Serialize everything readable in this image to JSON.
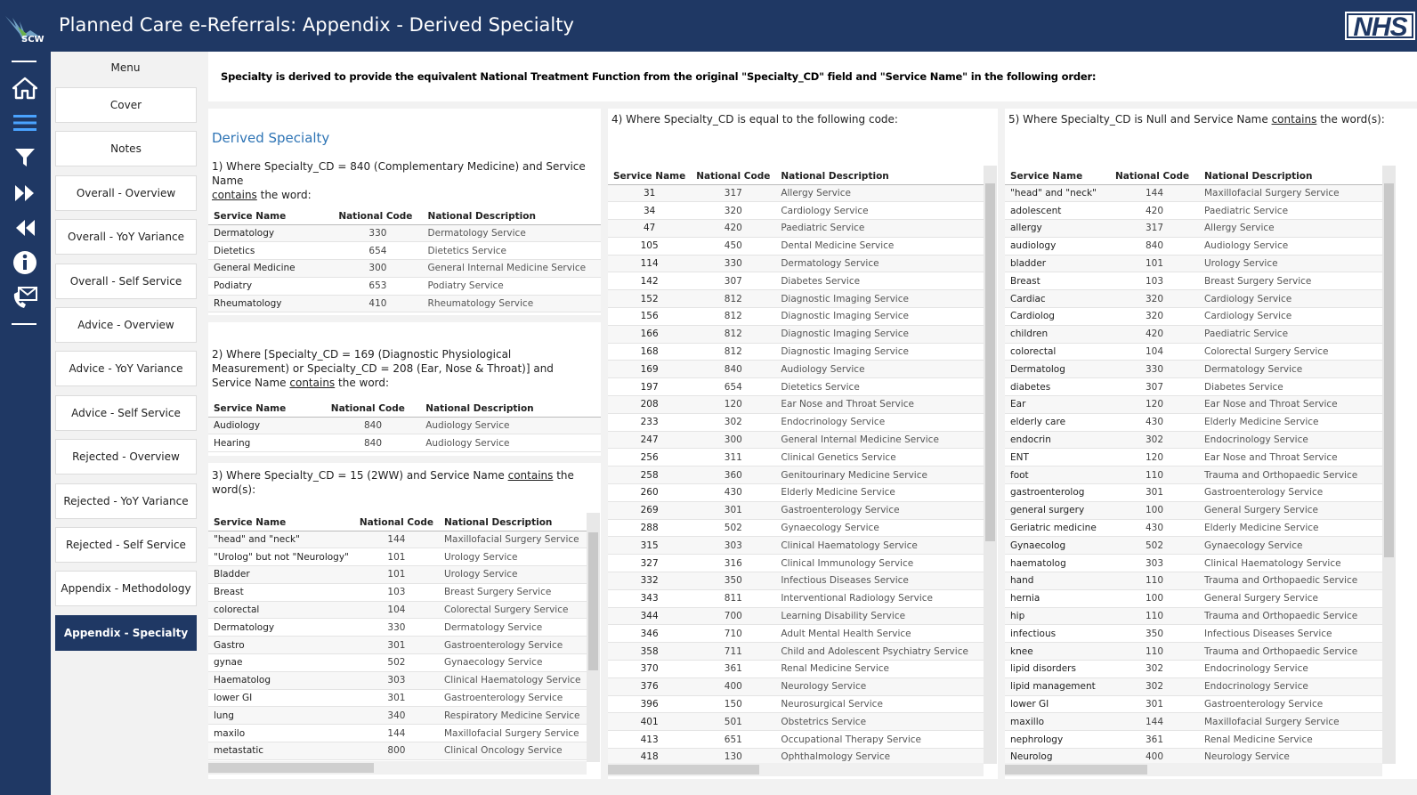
{
  "header": {
    "title": "Planned Care e-Referrals: Appendix - Derived Specialty",
    "logo_left": "SCW",
    "logo_right": "NHS"
  },
  "sidebar_icons": [
    "home-icon",
    "menu-icon",
    "filter-icon",
    "fast-forward-icon",
    "rewind-icon",
    "info-icon",
    "contact-icon"
  ],
  "menu": {
    "title": "Menu",
    "items": [
      "Cover",
      "Notes",
      "Overall - Overview",
      "Overall - YoY Variance",
      "Overall - Self Service",
      "Advice - Overview",
      "Advice - YoY Variance",
      "Advice - Self Service",
      "Rejected - Overview",
      "Rejected - YoY Variance",
      "Rejected - Self Service",
      "Appendix - Methodology",
      "Appendix - Specialty"
    ],
    "active": "Appendix - Specialty"
  },
  "intro_text": "Specialty is derived to provide the equivalent National Treatment Function from the original \"Specialty_CD\" field and \"Service Name\" in the following order:",
  "col1": {
    "title": "Derived Specialty",
    "s1": {
      "heading_a": "1) Where Specialty_CD = 840 (Complementary Medicine) and Service Name",
      "heading_u": "contains",
      "heading_b": " the word:",
      "headers": [
        "Service Name",
        "National Code",
        "National Description"
      ],
      "rows": [
        [
          "Dermatology",
          "330",
          "Dermatology Service"
        ],
        [
          "Dietetics",
          "654",
          "Dietetics Service"
        ],
        [
          "General Medicine",
          "300",
          "General Internal Medicine Service"
        ],
        [
          "Podiatry",
          "653",
          "Podiatry Service"
        ],
        [
          "Rheumatology",
          "410",
          "Rheumatology Service"
        ]
      ]
    },
    "s2": {
      "heading_a": "2) Where [Specialty_CD = 169 (Diagnostic Physiological Measurement) or Specialty_CD = 208 (Ear, Nose & Throat)] and Service Name ",
      "heading_u": "contains",
      "heading_b": " the word:",
      "headers": [
        "Service Name",
        "National Code",
        "National Description"
      ],
      "rows": [
        [
          "Audiology",
          "840",
          "Audiology Service"
        ],
        [
          "Hearing",
          "840",
          "Audiology Service"
        ]
      ]
    },
    "s3": {
      "heading_a": "3) Where Specialty_CD = 15 (2WW) and Service Name ",
      "heading_u": "contains",
      "heading_b": " the word(s):",
      "headers": [
        "Service Name",
        "National Code",
        "National Description"
      ],
      "rows": [
        [
          "\"head\"  and \"neck\"",
          "144",
          "Maxillofacial Surgery Service"
        ],
        [
          "\"Urolog\" but not \"Neurology\"",
          "101",
          "Urology Service"
        ],
        [
          "Bladder",
          "101",
          "Urology Service"
        ],
        [
          "Breast",
          "103",
          "Breast Surgery Service"
        ],
        [
          "colorectal",
          "104",
          "Colorectal Surgery Service"
        ],
        [
          "Dermatology",
          "330",
          "Dermatology Service"
        ],
        [
          "Gastro",
          "301",
          "Gastroenterology Service"
        ],
        [
          "gynae",
          "502",
          "Gynaecology Service"
        ],
        [
          "Haematolog",
          "303",
          "Clinical Haematology Service"
        ],
        [
          "lower GI",
          "301",
          "Gastroenterology Service"
        ],
        [
          "lung",
          "340",
          "Respiratory Medicine Service"
        ],
        [
          "maxilo",
          "144",
          "Maxillofacial Surgery Service"
        ],
        [
          "metastatic",
          "800",
          "Clinical Oncology Service"
        ]
      ]
    }
  },
  "col2": {
    "heading": "4) Where Specialty_CD is equal to the following code:",
    "headers": [
      "Service Name",
      "National Code",
      "National Description"
    ],
    "rows": [
      [
        "31",
        "317",
        "Allergy Service"
      ],
      [
        "34",
        "320",
        "Cardiology Service"
      ],
      [
        "47",
        "420",
        "Paediatric Service"
      ],
      [
        "105",
        "450",
        "Dental Medicine Service"
      ],
      [
        "114",
        "330",
        "Dermatology Service"
      ],
      [
        "142",
        "307",
        "Diabetes Service"
      ],
      [
        "152",
        "812",
        "Diagnostic Imaging Service"
      ],
      [
        "156",
        "812",
        "Diagnostic Imaging Service"
      ],
      [
        "166",
        "812",
        "Diagnostic Imaging Service"
      ],
      [
        "168",
        "812",
        "Diagnostic Imaging Service"
      ],
      [
        "169",
        "840",
        "Audiology Service"
      ],
      [
        "197",
        "654",
        "Dietetics Service"
      ],
      [
        "208",
        "120",
        "Ear Nose and Throat Service"
      ],
      [
        "233",
        "302",
        "Endocrinology Service"
      ],
      [
        "247",
        "300",
        "General Internal Medicine Service"
      ],
      [
        "256",
        "311",
        "Clinical Genetics Service"
      ],
      [
        "258",
        "360",
        "Genitourinary Medicine Service"
      ],
      [
        "260",
        "430",
        "Elderly Medicine Service"
      ],
      [
        "269",
        "301",
        "Gastroenterology Service"
      ],
      [
        "288",
        "502",
        "Gynaecology Service"
      ],
      [
        "315",
        "303",
        "Clinical Haematology Service"
      ],
      [
        "327",
        "316",
        "Clinical Immunology Service"
      ],
      [
        "332",
        "350",
        "Infectious Diseases Service"
      ],
      [
        "343",
        "811",
        "Interventional Radiology Service"
      ],
      [
        "344",
        "700",
        "Learning Disability Service"
      ],
      [
        "346",
        "710",
        "Adult Mental Health Service"
      ],
      [
        "358",
        "711",
        "Child and Adolescent Psychiatry Service"
      ],
      [
        "370",
        "361",
        "Renal Medicine Service"
      ],
      [
        "376",
        "400",
        "Neurology Service"
      ],
      [
        "396",
        "150",
        "Neurosurgical Service"
      ],
      [
        "401",
        "501",
        "Obstetrics Service"
      ],
      [
        "413",
        "651",
        "Occupational Therapy Service"
      ],
      [
        "418",
        "130",
        "Ophthalmology Service"
      ]
    ]
  },
  "col3": {
    "heading_a": "5) Where Specialty_CD is Null and Service Name ",
    "heading_u": "contains",
    "heading_b": " the word(s):",
    "headers": [
      "Service Name",
      "National Code",
      "National Description"
    ],
    "rows": [
      [
        "\"head\" and \"neck\"",
        "144",
        "Maxillofacial Surgery Service"
      ],
      [
        "adolescent",
        "420",
        "Paediatric Service"
      ],
      [
        "allergy",
        "317",
        "Allergy Service"
      ],
      [
        "audiology",
        "840",
        "Audiology Service"
      ],
      [
        "bladder",
        "101",
        "Urology Service"
      ],
      [
        "Breast",
        "103",
        "Breast Surgery Service"
      ],
      [
        "Cardiac",
        "320",
        "Cardiology Service"
      ],
      [
        "Cardiolog",
        "320",
        "Cardiology Service"
      ],
      [
        "children",
        "420",
        "Paediatric Service"
      ],
      [
        "colorectal",
        "104",
        "Colorectal Surgery Service"
      ],
      [
        "Dermatolog",
        "330",
        "Dermatology Service"
      ],
      [
        "diabetes",
        "307",
        "Diabetes Service"
      ],
      [
        "Ear",
        "120",
        "Ear Nose and Throat Service"
      ],
      [
        "elderly care",
        "430",
        "Elderly Medicine Service"
      ],
      [
        "endocrin",
        "302",
        "Endocrinology Service"
      ],
      [
        "ENT",
        "120",
        "Ear Nose and Throat Service"
      ],
      [
        "foot",
        "110",
        "Trauma and Orthopaedic Service"
      ],
      [
        "gastroenterolog",
        "301",
        "Gastroenterology Service"
      ],
      [
        "general surgery",
        "100",
        "General Surgery Service"
      ],
      [
        "Geriatric medicine",
        "430",
        "Elderly Medicine Service"
      ],
      [
        "Gynaecolog",
        "502",
        "Gynaecology Service"
      ],
      [
        "haematolog",
        "303",
        "Clinical Haematology Service"
      ],
      [
        "hand",
        "110",
        "Trauma and Orthopaedic Service"
      ],
      [
        "hernia",
        "100",
        "General Surgery Service"
      ],
      [
        "hip",
        "110",
        "Trauma and Orthopaedic Service"
      ],
      [
        "infectious",
        "350",
        "Infectious Diseases Service"
      ],
      [
        "knee",
        "110",
        "Trauma and Orthopaedic Service"
      ],
      [
        "lipid disorders",
        "302",
        "Endocrinology Service"
      ],
      [
        "lipid management",
        "302",
        "Endocrinology Service"
      ],
      [
        "lower GI",
        "301",
        "Gastroenterology Service"
      ],
      [
        "maxillo",
        "144",
        "Maxillofacial Surgery Service"
      ],
      [
        "nephrology",
        "361",
        "Renal Medicine Service"
      ],
      [
        "Neurolog",
        "400",
        "Neurology Service"
      ]
    ]
  }
}
